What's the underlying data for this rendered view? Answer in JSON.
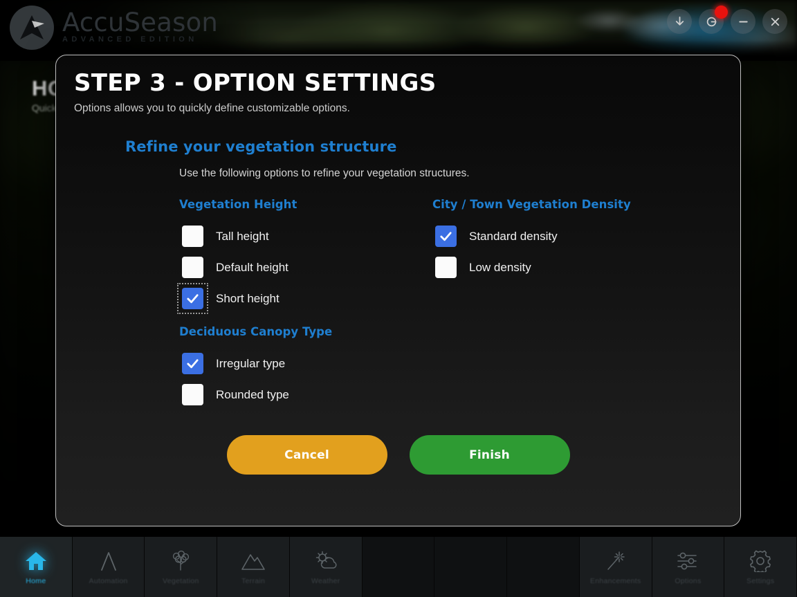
{
  "app": {
    "logo_title": "AccuSeason",
    "logo_subtitle": "ADVANCED EDITION",
    "logo_icon": "accuseason-arrow-logo"
  },
  "titlebar": {
    "buttons": [
      {
        "name": "download-button",
        "icon": "download-arrow-icon",
        "badge": false
      },
      {
        "name": "update-button",
        "icon": "refresh-gear-icon",
        "badge": true
      },
      {
        "name": "minimize-button",
        "icon": "minimize-icon",
        "badge": false
      },
      {
        "name": "close-button",
        "icon": "close-x-icon",
        "badge": false
      }
    ]
  },
  "background_page": {
    "title": "HOME",
    "subtitle": "Quick"
  },
  "dialog": {
    "title": "STEP 3 - OPTION SETTINGS",
    "subtitle": "Options allows you to quickly define customizable options.",
    "section_title": "Refine your vegetation structure",
    "section_description": "Use the following options to refine your vegetation structures.",
    "groups": [
      {
        "title": "Vegetation Height",
        "column": "left",
        "options": [
          {
            "label": "Tall height",
            "checked": false,
            "focused": false
          },
          {
            "label": "Default height",
            "checked": false,
            "focused": false
          },
          {
            "label": "Short height",
            "checked": true,
            "focused": true
          }
        ]
      },
      {
        "title": "Deciduous Canopy Type",
        "column": "left",
        "options": [
          {
            "label": "Irregular type",
            "checked": true,
            "focused": false
          },
          {
            "label": "Rounded type",
            "checked": false,
            "focused": false
          }
        ]
      },
      {
        "title": "City / Town Vegetation Density",
        "column": "right",
        "options": [
          {
            "label": "Standard density",
            "checked": true,
            "focused": false
          },
          {
            "label": "Low density",
            "checked": false,
            "focused": false
          }
        ]
      }
    ],
    "buttons": {
      "cancel_label": "Cancel",
      "finish_label": "Finish"
    }
  },
  "taskbar": {
    "items": [
      {
        "label": "Home",
        "icon": "home-icon",
        "active": true
      },
      {
        "label": "Automation",
        "icon": "automation-icon",
        "active": false
      },
      {
        "label": "Vegetation",
        "icon": "tree-icon",
        "active": false
      },
      {
        "label": "Terrain",
        "icon": "mountain-icon",
        "active": false
      },
      {
        "label": "Weather",
        "icon": "sun-cloud-icon",
        "active": false
      },
      {
        "label": "",
        "icon": "",
        "active": false
      },
      {
        "label": "",
        "icon": "",
        "active": false
      },
      {
        "label": "",
        "icon": "",
        "active": false
      },
      {
        "label": "Enhancements",
        "icon": "magic-wand-icon",
        "active": false
      },
      {
        "label": "Options",
        "icon": "sliders-icon",
        "active": false
      },
      {
        "label": "Settings",
        "icon": "gear-icon",
        "active": false
      }
    ]
  },
  "colors": {
    "accent_blue": "#1f7fd0",
    "checkbox_blue": "#3b6fe3",
    "cancel_orange": "#e2a01e",
    "finish_green": "#2e9b33",
    "active_cyan": "#29b7ea",
    "badge_red": "#e8120e"
  }
}
